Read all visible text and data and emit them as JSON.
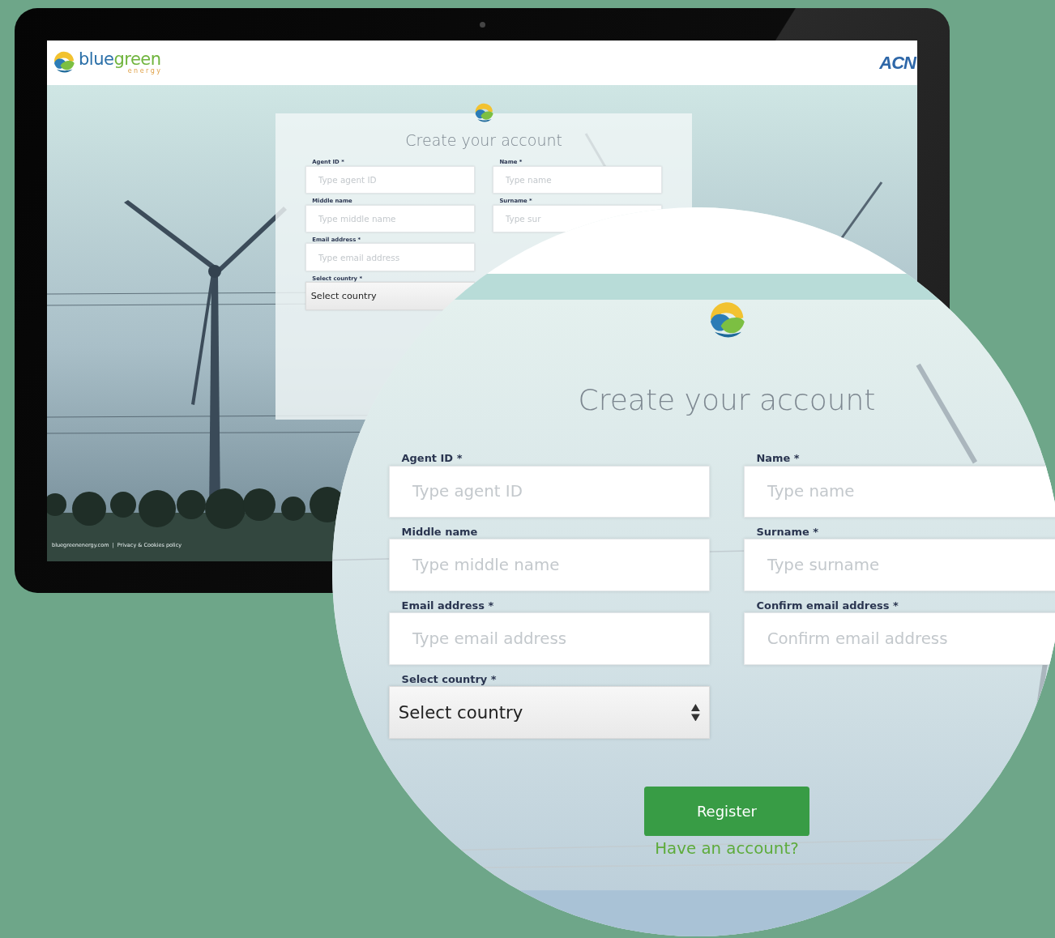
{
  "monitor": {
    "header": {
      "brand": {
        "name_parts": [
          "blue",
          "green"
        ],
        "tagline": "energy"
      },
      "partner": "ACN"
    },
    "form": {
      "title": "Create your account",
      "rows": [
        [
          {
            "kind": "input",
            "label": "Agent ID *",
            "placeholder": "Type agent ID"
          },
          {
            "kind": "input",
            "label": "Name *",
            "placeholder": "Type name"
          }
        ],
        [
          {
            "kind": "input",
            "label": "Middle name",
            "placeholder": "Type middle name"
          },
          {
            "kind": "input",
            "label": "Surname *",
            "placeholder": "Type sur"
          }
        ],
        [
          {
            "kind": "input",
            "label": "Email address *",
            "placeholder": "Type email address"
          }
        ],
        [
          {
            "kind": "select",
            "label": "Select country *",
            "value": "Select country"
          }
        ]
      ]
    },
    "footer": {
      "site": "bluegreenenergy.com",
      "separator": "|",
      "link": "Privacy & Cookies policy"
    }
  },
  "magnifier": {
    "form": {
      "title": "Create your account",
      "rows": [
        [
          {
            "kind": "input",
            "label": "Agent ID *",
            "placeholder": "Type agent ID"
          },
          {
            "kind": "input",
            "label": "Name *",
            "placeholder": "Type name"
          }
        ],
        [
          {
            "kind": "input",
            "label": "Middle name",
            "placeholder": "Type middle name"
          },
          {
            "kind": "input",
            "label": "Surname *",
            "placeholder": "Type surname"
          }
        ],
        [
          {
            "kind": "input",
            "label": "Email address *",
            "placeholder": "Type email address"
          },
          {
            "kind": "input",
            "label": "Confirm email address *",
            "placeholder": "Confirm email address"
          }
        ],
        [
          {
            "kind": "select",
            "label": "Select country *",
            "value": "Select country"
          }
        ]
      ],
      "submit": "Register",
      "login_link": "Have an account?"
    }
  }
}
